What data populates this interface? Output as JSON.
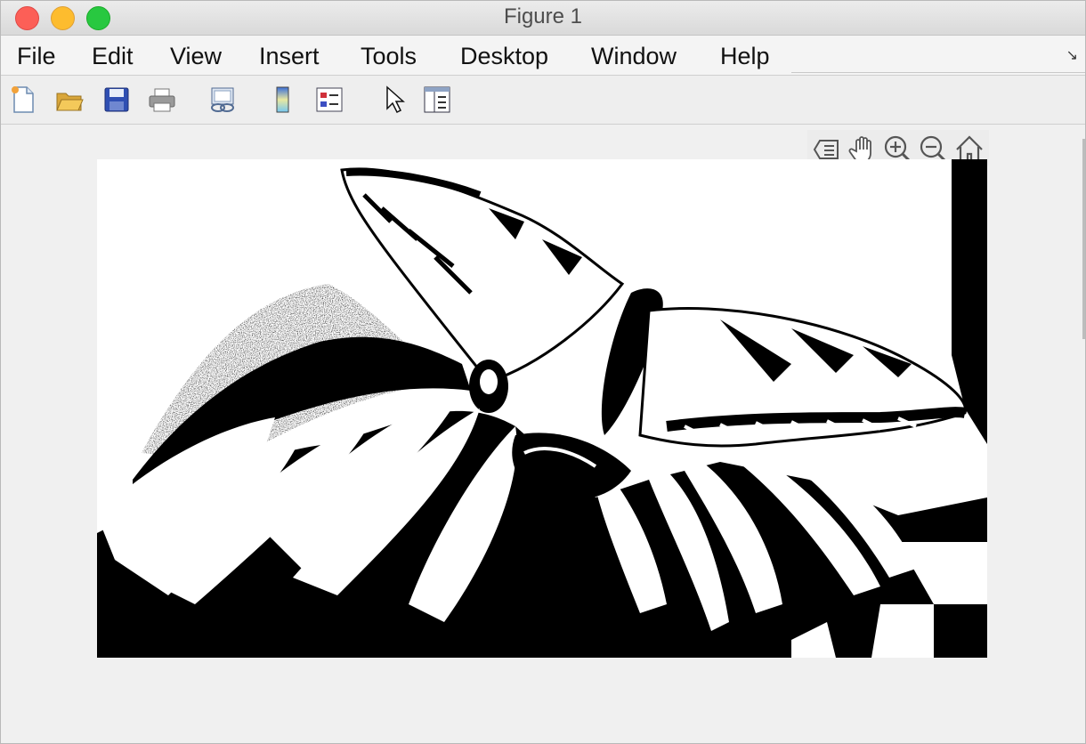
{
  "window": {
    "title": "Figure 1"
  },
  "menu": {
    "items": [
      {
        "label": "File"
      },
      {
        "label": "Edit"
      },
      {
        "label": "View"
      },
      {
        "label": "Insert"
      },
      {
        "label": "Tools"
      },
      {
        "label": "Desktop"
      },
      {
        "label": "Window"
      },
      {
        "label": "Help"
      }
    ]
  },
  "toolbar": {
    "buttons": [
      {
        "icon": "new-figure-icon"
      },
      {
        "icon": "open-file-icon"
      },
      {
        "icon": "save-icon"
      },
      {
        "icon": "print-icon"
      },
      {
        "icon": "link-plot-icon"
      },
      {
        "icon": "colorbar-icon"
      },
      {
        "icon": "legend-icon"
      },
      {
        "icon": "edit-plot-pointer-icon"
      },
      {
        "icon": "property-inspector-icon"
      }
    ]
  },
  "axes_toolbar": {
    "buttons": [
      {
        "icon": "data-tips-icon"
      },
      {
        "icon": "pan-hand-icon"
      },
      {
        "icon": "zoom-in-icon"
      },
      {
        "icon": "zoom-out-icon"
      },
      {
        "icon": "restore-view-home-icon"
      }
    ]
  },
  "image": {
    "content": "binary black-and-white image of a butterfly on a flower"
  },
  "colors": {
    "close": "#fc5f57",
    "minimize": "#fdbc2e",
    "maximize": "#28c840"
  }
}
